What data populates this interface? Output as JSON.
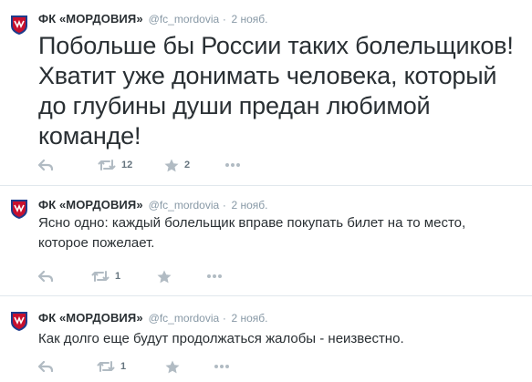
{
  "tweets": [
    {
      "author_name": "ФК «МОРДОВИЯ»",
      "handle": "@fc_mordovia",
      "separator": "·",
      "date": "2 нояб.",
      "text": "Побольше бы России таких болельщиков! Хватит уже донимать человека, который до глубины души предан любимой команде!",
      "retweets": "12",
      "favorites": "2"
    },
    {
      "author_name": "ФК «МОРДОВИЯ»",
      "handle": "@fc_mordovia",
      "separator": "·",
      "date": "2 нояб.",
      "text": "Ясно одно: каждый болельщик вправе покупать билет на то место, которое пожелает.",
      "retweets": "1",
      "favorites": ""
    },
    {
      "author_name": "ФК «МОРДОВИЯ»",
      "handle": "@fc_mordovia",
      "separator": "·",
      "date": "2 нояб.",
      "text": "Как долго еще будут продолжаться жалобы - неизвестно.",
      "retweets": "1",
      "favorites": ""
    }
  ],
  "icons": [
    "avatar-logo",
    "reply-icon",
    "retweet-icon",
    "favorite-icon",
    "more-icon"
  ],
  "colors": {
    "text": "#292f33",
    "secondary": "#8899a6",
    "icon": "#b1bbc3",
    "separator": "#e1e8ed",
    "logo_red": "#c8102e",
    "logo_blue": "#1d3c8c"
  }
}
